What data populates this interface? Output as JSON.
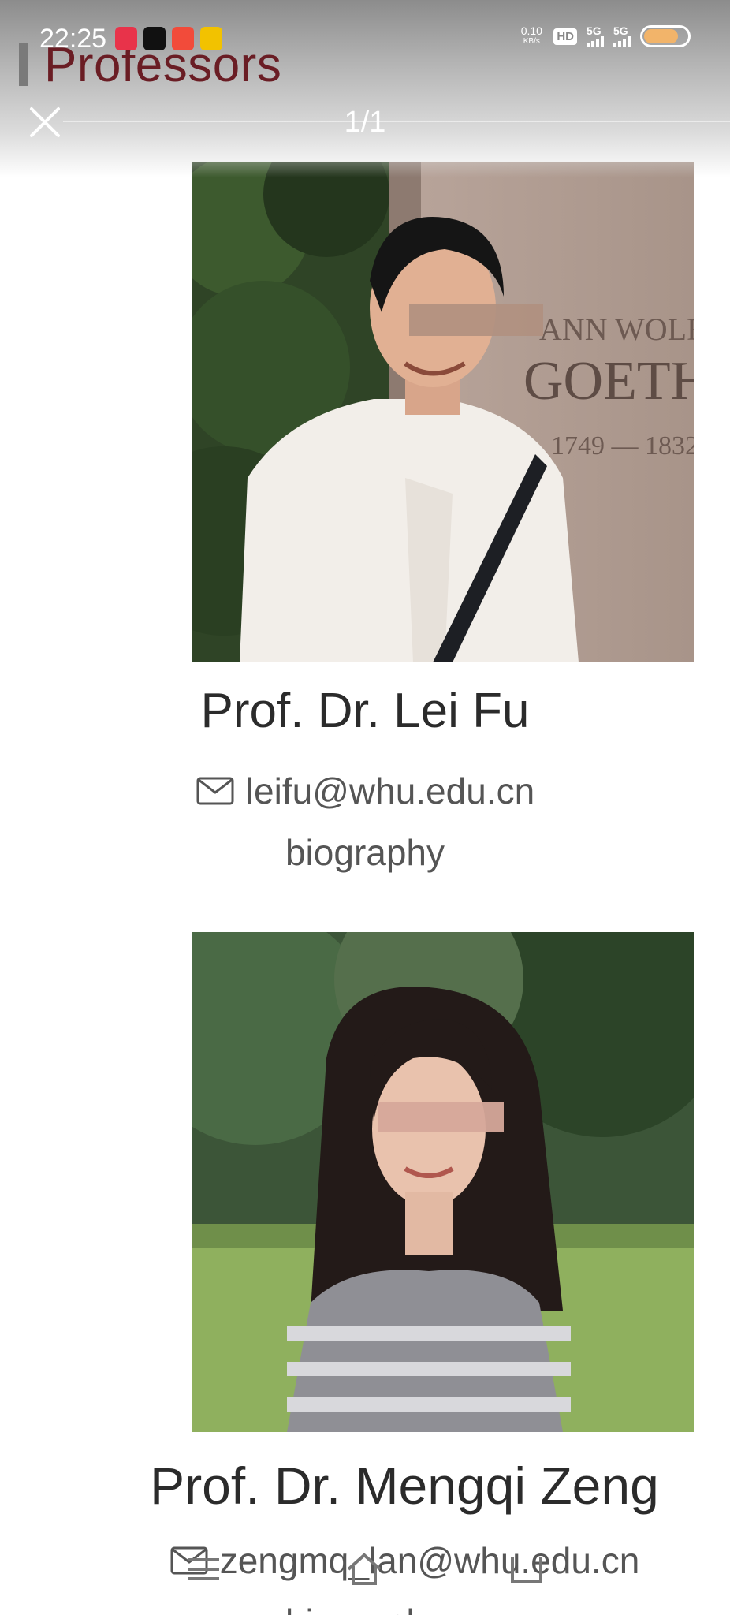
{
  "status_bar": {
    "time": "22:25",
    "net_speed_value": "0.10",
    "net_speed_unit": "KB/s",
    "hd_label": "HD",
    "signal1": "5G",
    "signal2": "5G",
    "battery_level": 0.8,
    "app_icon_colors": [
      "#e8334a",
      "#111111",
      "#f24b3a",
      "#f2c200"
    ]
  },
  "page": {
    "heading": "Professors",
    "heading_color": "#6a1d24"
  },
  "viewer": {
    "page_counter": "1/1"
  },
  "professors": [
    {
      "name": "Prof. Dr. Lei Fu",
      "email": "leifu@whu.edu.cn",
      "bio_label": "biography",
      "photo_description_icon": "portrait-photo"
    },
    {
      "name": "Prof. Dr. Mengqi Zeng",
      "email": "zengmq_lan@whu.edu.cn",
      "bio_label": "biography",
      "photo_description_icon": "portrait-photo"
    }
  ],
  "nav": {
    "icons": [
      "menu-icon",
      "home-icon",
      "back-icon"
    ]
  }
}
